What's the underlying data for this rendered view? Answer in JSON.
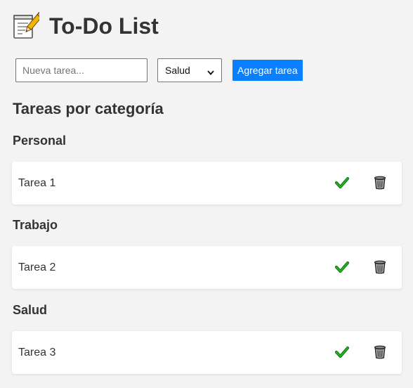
{
  "app": {
    "title": "To-Do List",
    "header_icon": "memo-pencil-icon"
  },
  "form": {
    "task_placeholder": "Nueva tarea...",
    "task_value": "",
    "category_selected": "Salud",
    "add_label": "Agregar tarea"
  },
  "main": {
    "section_title": "Tareas por categoría",
    "categories": [
      {
        "name": "Personal",
        "tasks": [
          {
            "text": "Tarea 1",
            "complete_icon": "checkmark-icon",
            "delete_icon": "trash-icon"
          }
        ]
      },
      {
        "name": "Trabajo",
        "tasks": [
          {
            "text": "Tarea 2",
            "complete_icon": "checkmark-icon",
            "delete_icon": "trash-icon"
          }
        ]
      },
      {
        "name": "Salud",
        "tasks": [
          {
            "text": "Tarea 3",
            "complete_icon": "checkmark-icon",
            "delete_icon": "trash-icon"
          }
        ]
      }
    ]
  },
  "colors": {
    "background": "#f3f3f3",
    "accent": "#0a80fe",
    "text": "#333333",
    "check": "#1a9a1a"
  }
}
